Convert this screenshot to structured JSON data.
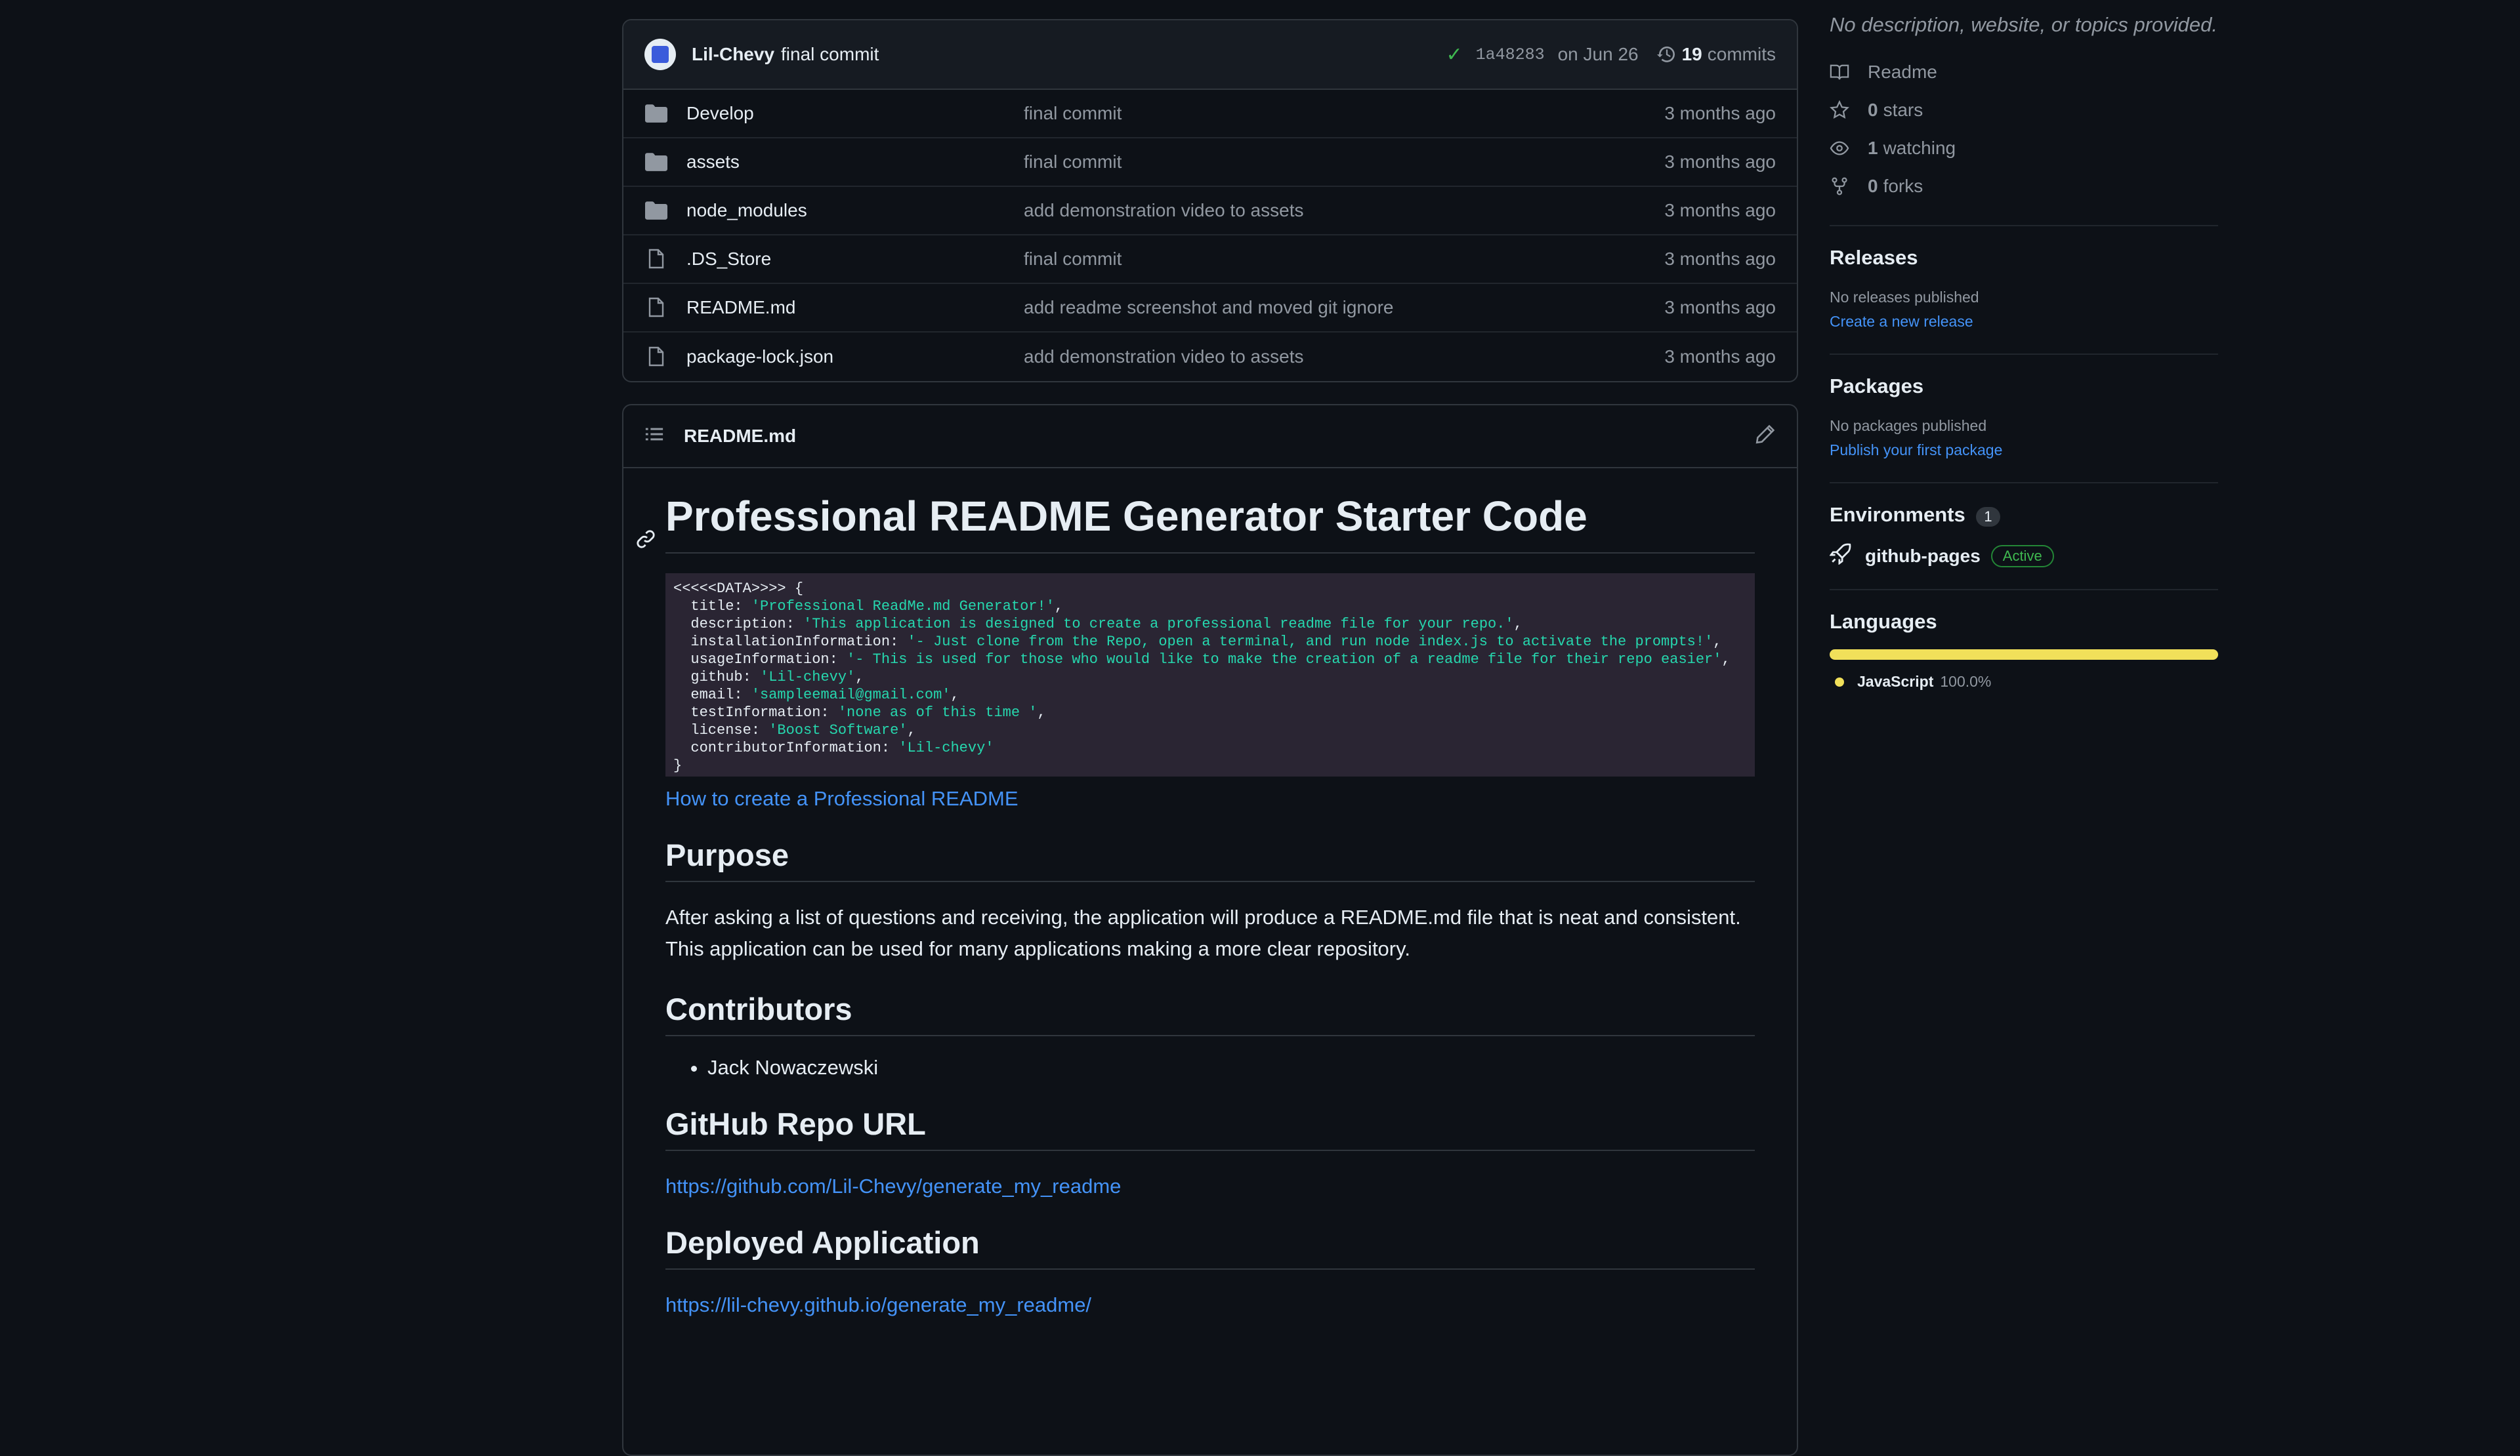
{
  "commit": {
    "author": "Lil-Chevy",
    "message": "final commit",
    "hash": "1a48283",
    "date": "on Jun 26",
    "count": "19",
    "count_label": "commits"
  },
  "files": [
    {
      "name": "Develop",
      "type": "folder",
      "commit": "final commit",
      "time": "3 months ago"
    },
    {
      "name": "assets",
      "type": "folder",
      "commit": "final commit",
      "time": "3 months ago"
    },
    {
      "name": "node_modules",
      "type": "folder",
      "commit": "add demonstration video to assets",
      "time": "3 months ago"
    },
    {
      "name": ".DS_Store",
      "type": "file",
      "commit": "final commit",
      "time": "3 months ago"
    },
    {
      "name": "README.md",
      "type": "file",
      "commit": "add readme screenshot and moved git ignore",
      "time": "3 months ago"
    },
    {
      "name": "package-lock.json",
      "type": "file",
      "commit": "add demonstration video to assets",
      "time": "3 months ago"
    }
  ],
  "readme": {
    "filename": "README.md",
    "h1": "Professional README Generator Starter Code",
    "code_lines": [
      {
        "k": "<<<<<DATA>>>> {",
        "v": ""
      },
      {
        "k": "  title: ",
        "v": "'Professional ReadMe.md Generator!'",
        "e": ","
      },
      {
        "k": "  description: ",
        "v": "'This application is designed to create a professional readme file for your repo.'",
        "e": ","
      },
      {
        "k": "  installationInformation: ",
        "v": "'- Just clone from the Repo, open a terminal, and run node index.js to activate the prompts!'",
        "e": ","
      },
      {
        "k": "  usageInformation: ",
        "v": "'- This is used for those who would like to make the creation of a readme file for their repo easier'",
        "e": ","
      },
      {
        "k": "  github: ",
        "v": "'Lil-chevy'",
        "e": ","
      },
      {
        "k": "  email: ",
        "v": "'sampleemail@gmail.com'",
        "e": ","
      },
      {
        "k": "  testInformation: ",
        "v": "'none as of this time '",
        "e": ","
      },
      {
        "k": "  license: ",
        "v": "'Boost Software'",
        "e": ","
      },
      {
        "k": "  contributorInformation: ",
        "v": "'Lil-chevy'",
        "e": ""
      },
      {
        "k": "}",
        "v": ""
      }
    ],
    "howto_link": "How to create a Professional README",
    "purpose_heading": "Purpose",
    "purpose_text": "After asking a list of questions and receiving, the application will produce a README.md file that is neat and consistent. This application can be used for many applications making a more clear repository.",
    "contributors_heading": "Contributors",
    "contributors": [
      "Jack Nowaczewski"
    ],
    "repo_heading": "GitHub Repo URL",
    "repo_url": "https://github.com/Lil-Chevy/generate_my_readme",
    "deployed_heading": "Deployed Application",
    "deployed_url": "https://lil-chevy.github.io/generate_my_readme/"
  },
  "sidebar": {
    "about": "No description, website, or topics provided.",
    "readme_label": "Readme",
    "stars_count": "0",
    "stars_label": "stars",
    "watching_count": "1",
    "watching_label": "watching",
    "forks_count": "0",
    "forks_label": "forks",
    "releases_heading": "Releases",
    "releases_none": "No releases published",
    "releases_link": "Create a new release",
    "packages_heading": "Packages",
    "packages_none": "No packages published",
    "packages_link": "Publish your first package",
    "environments_heading": "Environments",
    "environments_count": "1",
    "env_name": "github-pages",
    "env_status": "Active",
    "languages_heading": "Languages",
    "lang_name": "JavaScript",
    "lang_pct": "100.0%",
    "lang_color": "#f1e05a"
  }
}
